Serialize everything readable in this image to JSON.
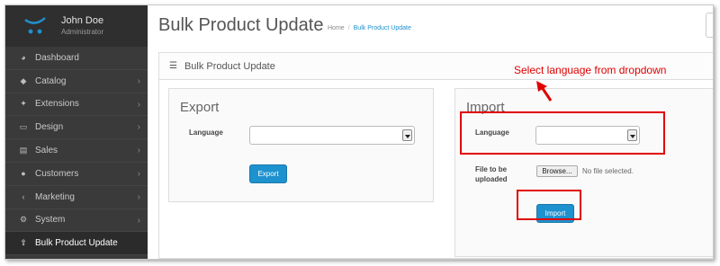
{
  "user": {
    "name": "John Doe",
    "role": "Administrator"
  },
  "sidebar": {
    "items": [
      {
        "label": "Dashboard",
        "icon": "dashboard-icon",
        "glyph": "◕",
        "has_children": false
      },
      {
        "label": "Catalog",
        "icon": "tag-icon",
        "glyph": "◆",
        "has_children": true
      },
      {
        "label": "Extensions",
        "icon": "puzzle-icon",
        "glyph": "✦",
        "has_children": true
      },
      {
        "label": "Design",
        "icon": "monitor-icon",
        "glyph": "▭",
        "has_children": true
      },
      {
        "label": "Sales",
        "icon": "cart-icon",
        "glyph": "▤",
        "has_children": true
      },
      {
        "label": "Customers",
        "icon": "user-icon",
        "glyph": "●",
        "has_children": true
      },
      {
        "label": "Marketing",
        "icon": "share-icon",
        "glyph": "‹",
        "has_children": true
      },
      {
        "label": "System",
        "icon": "gear-icon",
        "glyph": "⚙",
        "has_children": true
      },
      {
        "label": "Bulk Product Update",
        "icon": "upload-icon",
        "glyph": "⇧",
        "has_children": false,
        "active": true
      }
    ],
    "chevron": "›"
  },
  "header": {
    "title": "Bulk Product Update",
    "breadcrumb": {
      "home": "Home",
      "separator": "/",
      "current": "Bulk Product Update"
    }
  },
  "panel": {
    "title": "Bulk Product Update",
    "icon": "list-icon",
    "glyph": "☰"
  },
  "export": {
    "title": "Export",
    "language_label": "Language",
    "language_value": "",
    "button_label": "Export"
  },
  "import": {
    "title": "Import",
    "language_label": "Language",
    "language_value": "",
    "file_label_line1": "File to be",
    "file_label_line2": "uploaded",
    "browse_label": "Browse...",
    "file_status": "No file selected.",
    "button_label": "Import"
  },
  "annotation": {
    "text": "Select language from dropdown",
    "color": "#e00000"
  },
  "colors": {
    "accent": "#1e91cf",
    "sidebar_bg": "#3a3a3a",
    "highlight": "#e00000"
  }
}
